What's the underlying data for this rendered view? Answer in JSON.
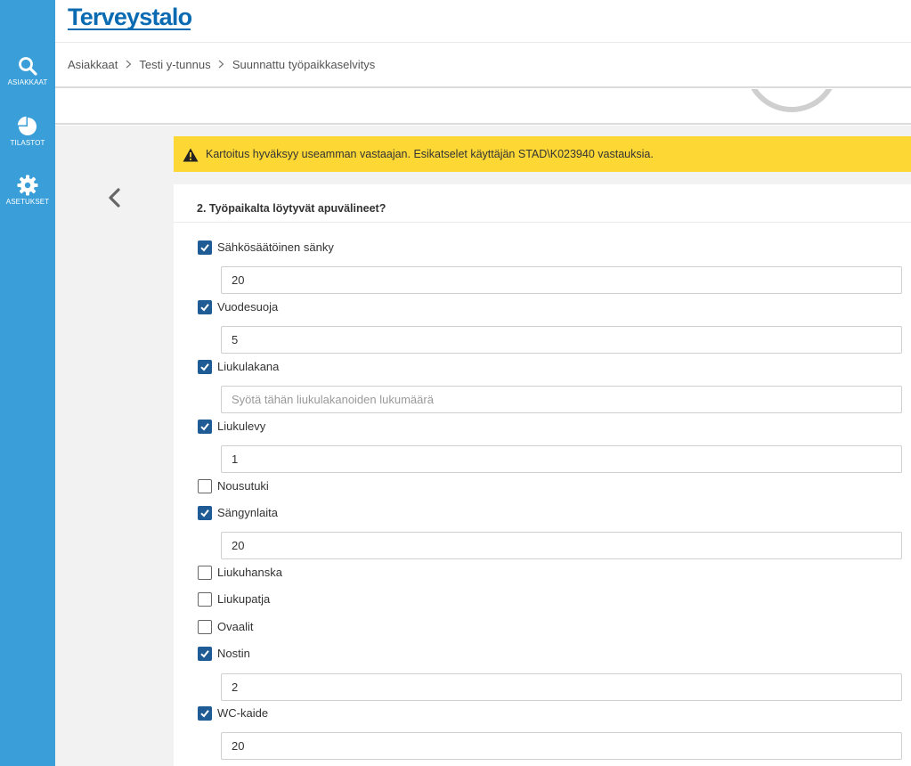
{
  "sidebar": {
    "items": [
      {
        "label": "ASIAKKAAT",
        "icon": "search-icon"
      },
      {
        "label": "TILASTOT",
        "icon": "pie-chart-icon"
      },
      {
        "label": "ASETUKSET",
        "icon": "gear-icon"
      }
    ],
    "color": "#3a9fd8"
  },
  "header": {
    "logo_text": "Terveystalo",
    "brand_color": "#0a6bb3"
  },
  "breadcrumb": [
    "Asiakkaat",
    "Testi y-tunnus",
    "Suunnattu työpaikkaselvitys"
  ],
  "alert": {
    "text": "Kartoitus hyväksyy useamman vastaajan. Esikatselet käyttäjän STAD\\K023940 vastauksia.",
    "color": "#fdd835"
  },
  "question": {
    "title": "2. Työpaikalta löytyvät apuvälineet?",
    "options": [
      {
        "label": "Sähkösäätöinen sänky",
        "checked": true,
        "value": "20",
        "placeholder": ""
      },
      {
        "label": "Vuodesuoja",
        "checked": true,
        "value": "5",
        "placeholder": ""
      },
      {
        "label": "Liukulakana",
        "checked": true,
        "value": "",
        "placeholder": "Syötä tähän liukulakanoiden lukumäärä"
      },
      {
        "label": "Liukulevy",
        "checked": true,
        "value": "1",
        "placeholder": ""
      },
      {
        "label": "Nousutuki",
        "checked": false
      },
      {
        "label": "Sängynlaita",
        "checked": true,
        "value": "20",
        "placeholder": ""
      },
      {
        "label": "Liukuhanska",
        "checked": false
      },
      {
        "label": "Liukupatja",
        "checked": false
      },
      {
        "label": "Ovaalit",
        "checked": false
      },
      {
        "label": "Nostin",
        "checked": true,
        "value": "2",
        "placeholder": ""
      },
      {
        "label": "WC-kaide",
        "checked": true,
        "value": "20",
        "placeholder": ""
      }
    ]
  }
}
